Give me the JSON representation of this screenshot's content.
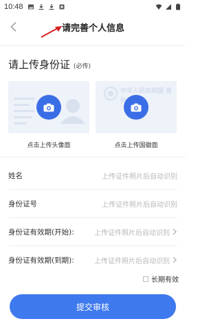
{
  "status_bar": {
    "time": "10:48"
  },
  "header": {
    "title": "请完善个人信息"
  },
  "upload": {
    "title": "请上传身份证",
    "subtitle": "(必传)",
    "front_label": "点击上传头像面",
    "back_label": "点击上传国徽面",
    "back_watermark": "中华人民共和国 身份证"
  },
  "form": {
    "rows": [
      {
        "label": "姓名",
        "value": "上传证件照片后自动识别",
        "chevron": false
      },
      {
        "label": "身份证号",
        "value": "上传证件照片后自动识别",
        "chevron": false
      },
      {
        "label": "身份证有效期(开始):",
        "value": "上传证件照片后自动识别",
        "chevron": true
      },
      {
        "label": "身份证有效期(到期):",
        "value": "上传证件照片后自动识别",
        "chevron": true
      }
    ],
    "long_term_label": "长期有效",
    "long_term_checked": false
  },
  "actions": {
    "submit_label": "提交审核"
  },
  "colors": {
    "accent": "#3f79ee",
    "card_bg": "#eef2f9",
    "placeholder": "#b8b8b8",
    "annotation": "#d81e1e"
  },
  "icons": [
    "image-icon",
    "download-icon",
    "download-icon",
    "notification-icon",
    "wifi-icon",
    "signal-icon",
    "battery-icon",
    "back-arrow-icon",
    "camera-icon",
    "chevron-right-icon"
  ]
}
